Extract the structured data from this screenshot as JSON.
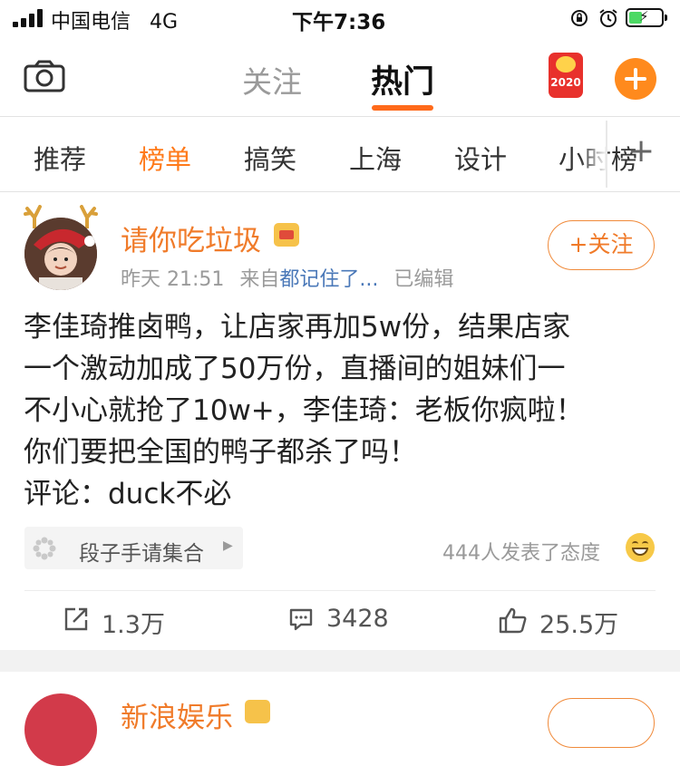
{
  "status_bar": {
    "carrier": "中国电信",
    "network": "4G",
    "time": "下午7:36"
  },
  "top_nav": {
    "tab_follow": "关注",
    "tab_hot": "热门",
    "redpacket_year": "2020"
  },
  "channels": [
    "推荐",
    "榜单",
    "搞笑",
    "上海",
    "设计",
    "小时榜"
  ],
  "post": {
    "username": "请你吃垃圾",
    "time": "昨天 21:51",
    "source_prefix": "来自",
    "source": "都记住了...",
    "edited": "已编辑",
    "follow_label": "+关注",
    "text_lines": [
      "李佳琦推卤鸭，让店家再加5w份，结果店家",
      "一个激动加成了50万份，直播间的姐妹们一",
      "不小心就抢了10w+，李佳琦：老板你疯啦！",
      "你们要把全国的鸭子都杀了吗！",
      "评论：duck不必"
    ],
    "topic": "段子手请集合",
    "reactions_text": "444人发表了态度",
    "repost_count": "1.3万",
    "comment_count": "3428",
    "like_count": "25.5万"
  },
  "next_post": {
    "username": "新浪娱乐"
  },
  "colors": {
    "accent_orange": "#ff7a1a",
    "username_orange": "#f07b2a",
    "link_blue": "#4a78b8"
  }
}
